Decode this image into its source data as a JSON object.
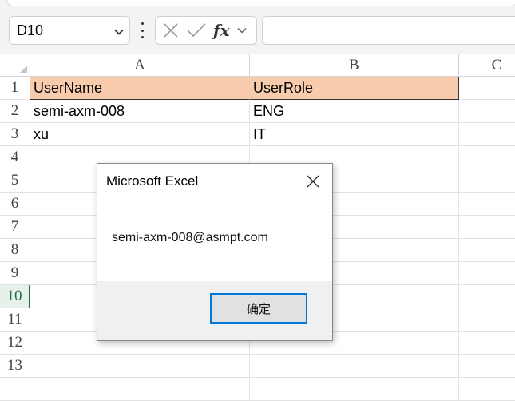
{
  "name_box": {
    "value": "D10",
    "icon": "chevron-down-icon"
  },
  "formula_bar": {
    "cancel_icon": "close-icon",
    "enter_icon": "check-icon",
    "fx_label": "fx",
    "value": ""
  },
  "columns": [
    "A",
    "B",
    "C"
  ],
  "rows": [
    "1",
    "2",
    "3",
    "4",
    "5",
    "6",
    "7",
    "8",
    "9",
    "10",
    "11",
    "12",
    "13"
  ],
  "active_row": "10",
  "cells": {
    "A1": "UserName",
    "B1": "UserRole",
    "A2": "semi-axm-008",
    "B2": "ENG",
    "A3": "xu",
    "B3": "IT"
  },
  "colors": {
    "header_fill": "#f8cbad",
    "accent": "#1e7145",
    "focus": "#0078d7"
  },
  "dialog": {
    "title": "Microsoft Excel",
    "message": "semi-axm-008@asmpt.com",
    "ok_label": "确定",
    "close_icon": "close-icon"
  }
}
